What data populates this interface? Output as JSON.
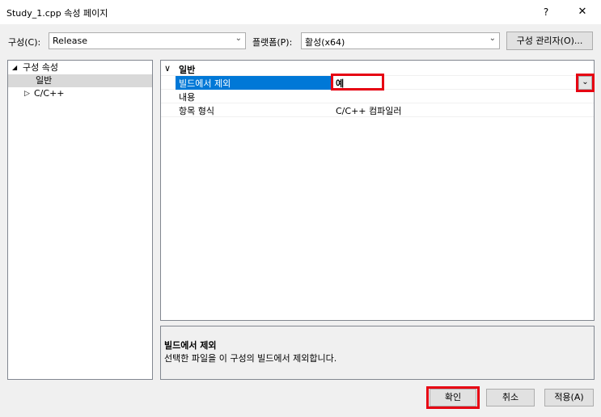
{
  "window": {
    "title": "Study_1.cpp 속성 페이지",
    "help_label": "?",
    "close_label": "✕"
  },
  "toolbar": {
    "config_label": "구성(C):",
    "config_value": "Release",
    "platform_label": "플랫폼(P):",
    "platform_value": "활성(x64)",
    "config_manager_label": "구성 관리자(O)..."
  },
  "tree": {
    "root_label": "구성 속성",
    "root_glyph": "◢",
    "items": [
      {
        "label": "일반"
      },
      {
        "label": "C/C++",
        "glyph": "▷"
      }
    ]
  },
  "grid": {
    "category": "일반",
    "category_glyph": "∨",
    "rows": [
      {
        "name": "빌드에서 제외",
        "value": "예"
      },
      {
        "name": "내용",
        "value": ""
      },
      {
        "name": "항목 형식",
        "value": "C/C++ 컴파일러"
      }
    ],
    "dropdown_glyph": "⌄"
  },
  "description": {
    "title": "빌드에서 제외",
    "text": "선택한 파일을 이 구성의 빌드에서 제외합니다."
  },
  "buttons": {
    "ok": "확인",
    "cancel": "취소",
    "apply": "적용(A)"
  },
  "colors": {
    "selection": "#0078d7",
    "highlight": "#e60012"
  }
}
